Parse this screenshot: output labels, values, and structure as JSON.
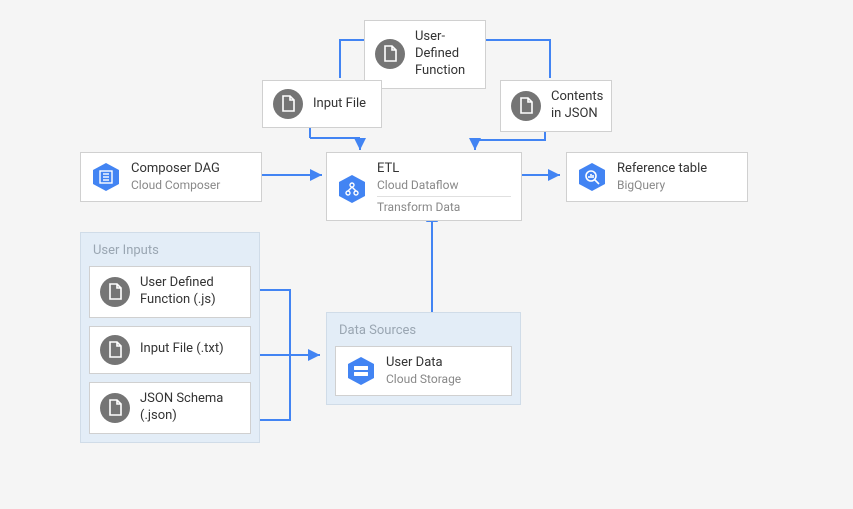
{
  "nodes": {
    "udf_top": {
      "title": "User-Defined",
      "subtitle": "Function"
    },
    "input_file": {
      "title": "Input File"
    },
    "contents_json": {
      "title": "Contents",
      "subtitle": "in JSON"
    },
    "composer": {
      "title": "Composer DAG",
      "subtitle": "Cloud Composer"
    },
    "etl": {
      "title": "ETL",
      "subtitle": "Cloud Dataflow",
      "subtitle2": "Transform Data"
    },
    "bigquery": {
      "title": "Reference table",
      "subtitle": "BigQuery"
    }
  },
  "groups": {
    "user_inputs": {
      "title": "User Inputs",
      "items": [
        {
          "title": "User Defined",
          "subtitle": "Function (.js)"
        },
        {
          "title": "Input File (.txt)"
        },
        {
          "title": "JSON Schema",
          "subtitle": "(.json)"
        }
      ]
    },
    "data_sources": {
      "title": "Data Sources",
      "items": [
        {
          "title": "User Data",
          "subtitle": "Cloud Storage"
        }
      ]
    }
  },
  "colors": {
    "arrow": "#4284f3",
    "icon_gray": "#757575",
    "icon_blue": "#4284f3",
    "group_bg": "#e3edf7"
  }
}
